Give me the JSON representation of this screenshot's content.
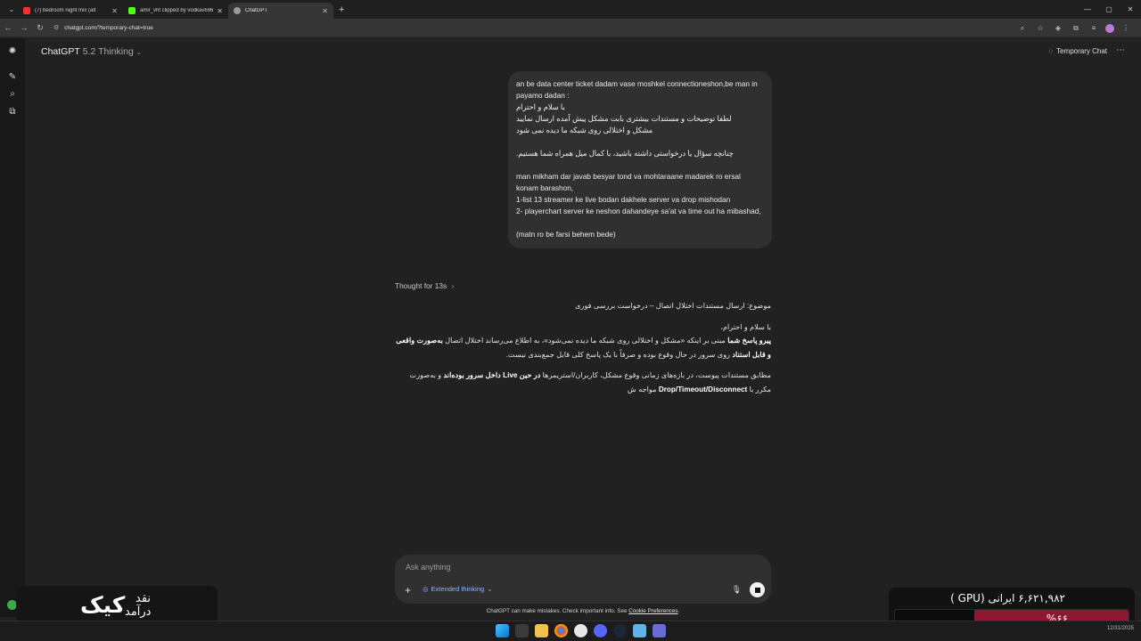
{
  "browser": {
    "tabs": [
      {
        "title": "(7) bedroom night mix (alt",
        "color": "#ff2d2d"
      },
      {
        "title": "amir_vht clipped by vodkav696",
        "color": "#53fc18"
      },
      {
        "title": "ChatGPT",
        "color": "#9a9a9a"
      }
    ],
    "url": "chatgpt.com/?temporary-chat=true"
  },
  "header": {
    "model_name": "ChatGPT",
    "model_version": "5.2 Thinking",
    "temporary_chat": "Temporary Chat"
  },
  "conversation": {
    "user_message": [
      "an be data center ticket dadam vase moshkel connectioneshon,be man in payamo dadan :",
      "با سلام و احترام",
      "لطفا توضیحات و مستندات بیشتری بابت مشکل پیش آمده ارسال نمایید",
      "مشکل و اختلالی روی شبکه ما دیده نمی شود",
      "",
      "چنانچه سؤال یا درخواستی داشته باشید، با کمال میل همراه شما هستیم.",
      "",
      "man mikham dar javab besyar tond va mohtaraane madarek ro ersal konam barashon,",
      "1-list 13 streamer ke live bodan dakhele server va drop mishodan",
      "2- playerchart server ke neshon dahandeye sa'at va time out ha mibashad,",
      "",
      "(matn ro be farsi behem bede)"
    ],
    "thought_label": "Thought for 13s",
    "assistant": {
      "subject": "موضوع: ارسال مستندات اختلال اتصال – درخواست بررسی فوری",
      "p1_a": "با سلام و احترام،",
      "p1_b_bold": "پیرو پاسخ شما",
      "p1_c": " مبنی بر اینکه «مشکل و اختلالی روی شبکه ما دیده نمی‌شود»، به اطلاع می‌رساند اختلال اتصال ",
      "p1_d_bold": "به‌صورت واقعی و قابل استناد",
      "p1_e": " روی سرور در حال وقوع بوده و صرفاً با یک پاسخ کلی قابل جمع‌بندی نیست.",
      "p2_a": "مطابق مستندات پیوست، در بازه‌های زمانی وقوع مشکل، کاربران/استریمرها ",
      "p2_b_bold": "در حین Live داخل سرور بوده‌اند",
      "p2_c": " و به‌صورت مکرر با ",
      "p2_d_bold": "Drop/Timeout/Disconnect",
      "p2_e": " مواجه ش"
    }
  },
  "composer": {
    "placeholder": "Ask anything",
    "mode": "Extended thinking"
  },
  "disclaimer": {
    "text": "ChatGPT can make mistakes. Check important info. See ",
    "link": "Cookie Preferences",
    "end": "."
  },
  "overlay_left": {
    "big": "کیک",
    "line1": "نقد",
    "line2": "درآمد"
  },
  "overlay_right": {
    "text": "۶,۶۲۱,۹۸۲ ایرانی (GPU )",
    "percent_label": "%۶۶",
    "percent": 0.66,
    "bar_color": "#8d1830"
  },
  "taskbar": {
    "date": "12/31/2025"
  }
}
